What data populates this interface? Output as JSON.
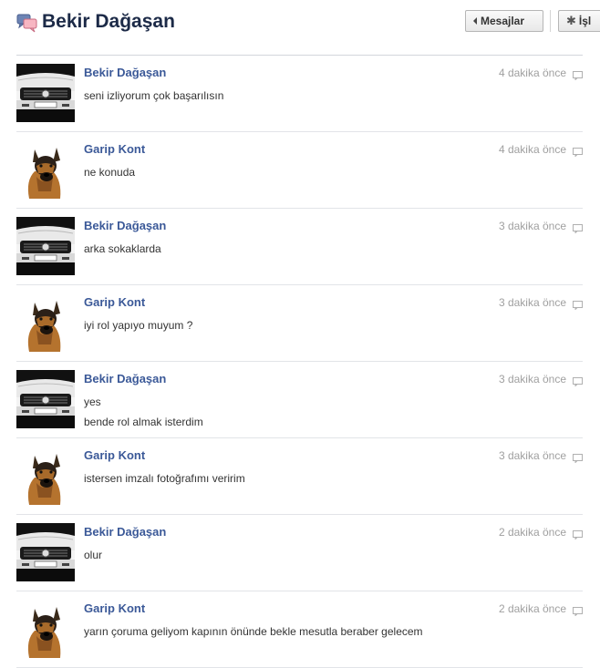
{
  "header": {
    "title": "Bekir Dağaşan",
    "back_label": "Mesajlar",
    "actions_label": "İşl"
  },
  "messages": [
    {
      "sender": "Bekir Dağaşan",
      "avatar": "car-icon",
      "lines": [
        "seni izliyorum çok başarılısın"
      ],
      "time": "4 dakika önce"
    },
    {
      "sender": "Garip Kont",
      "avatar": "dog-icon",
      "lines": [
        "ne konuda"
      ],
      "time": "4 dakika önce"
    },
    {
      "sender": "Bekir Dağaşan",
      "avatar": "car-icon",
      "lines": [
        "arka sokaklarda"
      ],
      "time": "3 dakika önce"
    },
    {
      "sender": "Garip Kont",
      "avatar": "dog-icon",
      "lines": [
        "iyi rol yapıyo muyum ?"
      ],
      "time": "3 dakika önce"
    },
    {
      "sender": "Bekir Dağaşan",
      "avatar": "car-icon",
      "lines": [
        "yes",
        "bende rol almak isterdim"
      ],
      "time": "3 dakika önce"
    },
    {
      "sender": "Garip Kont",
      "avatar": "dog-icon",
      "lines": [
        "istersen imzalı fotoğrafımı veririm"
      ],
      "time": "3 dakika önce"
    },
    {
      "sender": "Bekir Dağaşan",
      "avatar": "car-icon",
      "lines": [
        "olur"
      ],
      "time": "2 dakika önce"
    },
    {
      "sender": "Garip Kont",
      "avatar": "dog-icon",
      "lines": [
        "yarın çoruma geliyom kapının önünde bekle mesutla beraber gelecem"
      ],
      "time": "2 dakika önce"
    }
  ],
  "colors": {
    "sender_link": "#3b5998",
    "timestamp": "#a0a0a0",
    "title": "#1c2a47"
  }
}
